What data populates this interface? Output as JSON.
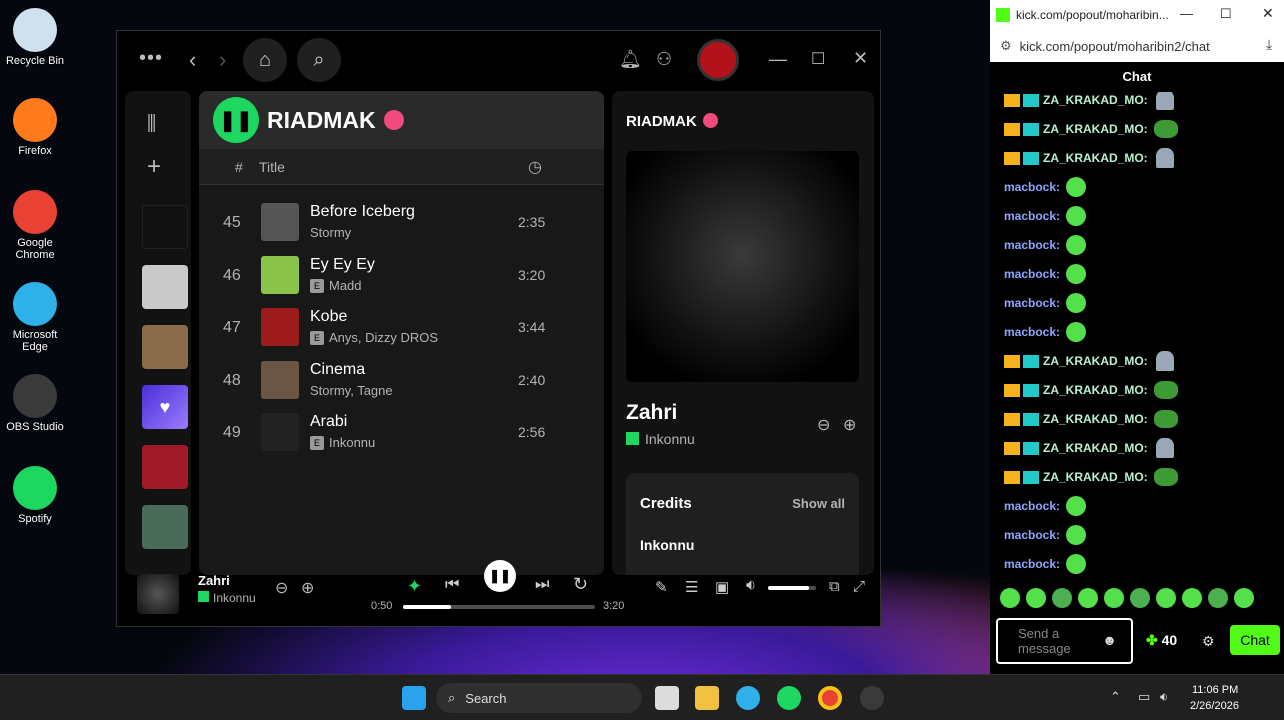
{
  "desktop": {
    "icons": [
      {
        "label": "Recycle Bin",
        "color": "#cfe0ef"
      },
      {
        "label": "Firefox",
        "color": "#ff7a1a"
      },
      {
        "label": "Google Chrome",
        "color": "#e94235"
      },
      {
        "label": "Microsoft Edge",
        "color": "#2fb0e8"
      },
      {
        "label": "OBS Studio",
        "color": "#3a3a3a"
      },
      {
        "label": "Spotify",
        "color": "#1ed760"
      }
    ]
  },
  "spotify": {
    "playlist_title": "RIADMAK",
    "col_number": "#",
    "col_title": "Title",
    "tracks": [
      {
        "num": "45",
        "title": "Before Iceberg",
        "artist": "Stormy",
        "explicit": false,
        "duration": "2:35"
      },
      {
        "num": "46",
        "title": "Ey Ey Ey",
        "artist": "Madd",
        "explicit": true,
        "duration": "3:20"
      },
      {
        "num": "47",
        "title": "Kobe",
        "artist": "Anys, Dizzy DROS",
        "explicit": true,
        "duration": "3:44"
      },
      {
        "num": "48",
        "title": "Cinema",
        "artist": "Stormy, Tagne",
        "explicit": false,
        "duration": "2:40"
      },
      {
        "num": "49",
        "title": "Arabi",
        "artist": "Inkonnu",
        "explicit": true,
        "duration": "2:56"
      }
    ],
    "right_panel": {
      "title": "RIADMAK",
      "song": "Zahri",
      "artist": "Inkonnu",
      "credits_label": "Credits",
      "show_all": "Show all",
      "credit_first": "Inkonnu"
    },
    "player": {
      "song": "Zahri",
      "artist": "Inkonnu",
      "elapsed": "0:50",
      "total": "3:20",
      "progress": 0.25,
      "volume": 0.85
    },
    "accent": "#1ed760"
  },
  "chat": {
    "tab_title": "kick.com/popout/moharibin...",
    "url": "kick.com/popout/moharibin2/chat",
    "header": "Chat",
    "messages": [
      {
        "user": "ZA_KRAKAD_MO:",
        "type": "za",
        "emote": "bird"
      },
      {
        "user": "ZA_KRAKAD_MO:",
        "type": "za",
        "emote": "pepe"
      },
      {
        "user": "ZA_KRAKAD_MO:",
        "type": "za",
        "emote": "bird"
      },
      {
        "user": "macbock:",
        "type": "mac",
        "emote": "blob"
      },
      {
        "user": "macbock:",
        "type": "mac",
        "emote": "blob"
      },
      {
        "user": "macbock:",
        "type": "mac",
        "emote": "blob"
      },
      {
        "user": "macbock:",
        "type": "mac",
        "emote": "blob"
      },
      {
        "user": "macbock:",
        "type": "mac",
        "emote": "blob"
      },
      {
        "user": "macbock:",
        "type": "mac",
        "emote": "blob"
      },
      {
        "user": "ZA_KRAKAD_MO:",
        "type": "za",
        "emote": "bird"
      },
      {
        "user": "ZA_KRAKAD_MO:",
        "type": "za",
        "emote": "pepe"
      },
      {
        "user": "ZA_KRAKAD_MO:",
        "type": "za",
        "emote": "pepe"
      },
      {
        "user": "ZA_KRAKAD_MO:",
        "type": "za",
        "emote": "bird"
      },
      {
        "user": "ZA_KRAKAD_MO:",
        "type": "za",
        "emote": "pepe"
      },
      {
        "user": "macbock:",
        "type": "mac",
        "emote": "blob"
      },
      {
        "user": "macbock:",
        "type": "mac",
        "emote": "blob"
      },
      {
        "user": "macbock:",
        "type": "mac",
        "emote": "blob"
      }
    ],
    "input_placeholder": "Send a message",
    "points": "40",
    "send_label": "Chat",
    "accent": "#53fc18"
  },
  "taskbar": {
    "search_label": "Search",
    "time": "11:06 PM",
    "date": "2/26/2026"
  }
}
